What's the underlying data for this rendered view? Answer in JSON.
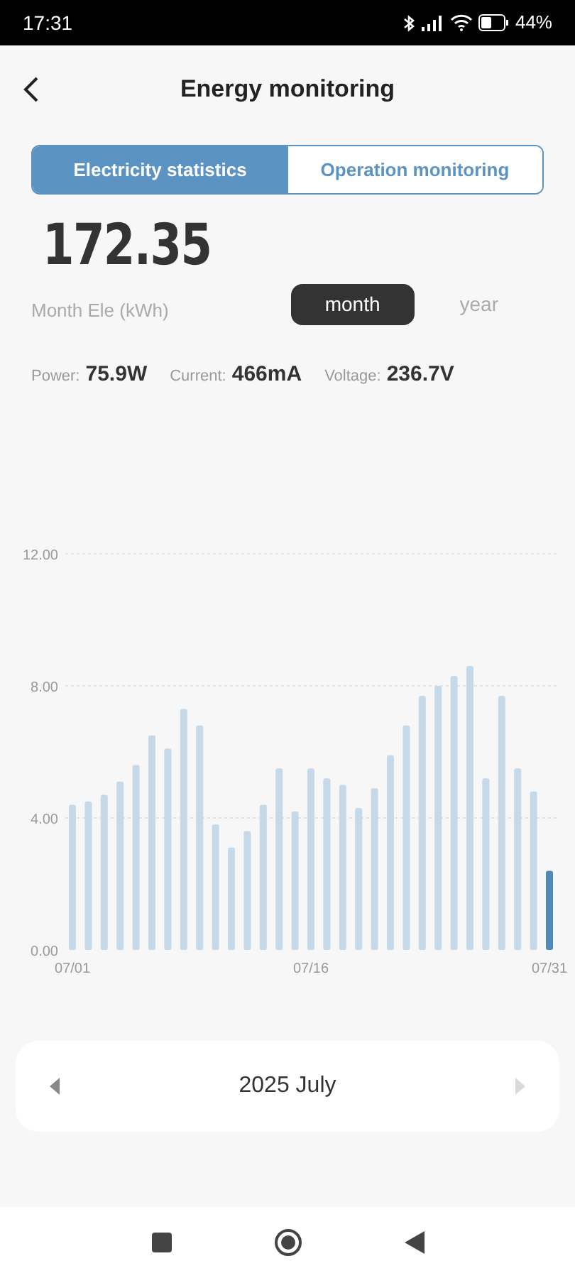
{
  "status_bar": {
    "time": "17:31",
    "battery": "44%"
  },
  "header": {
    "title": "Energy monitoring"
  },
  "tabs": [
    {
      "label": "Electricity statistics",
      "selected": true
    },
    {
      "label": "Operation monitoring",
      "selected": false
    }
  ],
  "total": {
    "value": "172.35",
    "label": "Month Ele (kWh)"
  },
  "period": [
    {
      "label": "month",
      "selected": true
    },
    {
      "label": "year",
      "selected": false
    }
  ],
  "readings": [
    {
      "label": "Power:",
      "value": "75.9W"
    },
    {
      "label": "Current:",
      "value": "466mA"
    },
    {
      "label": "Voltage:",
      "value": "236.7V"
    }
  ],
  "chart": {
    "chart_data": {
      "type": "bar",
      "categories": [
        "07/01",
        null,
        null,
        null,
        null,
        null,
        null,
        null,
        null,
        null,
        null,
        null,
        null,
        null,
        null,
        "07/16",
        null,
        null,
        null,
        null,
        null,
        null,
        null,
        null,
        null,
        null,
        null,
        null,
        null,
        null,
        "07/31"
      ],
      "stacked": true,
      "series": [
        {
          "color": "#c5d9e8",
          "values": [
            4.4,
            4.5,
            4.7,
            5.1,
            5.6,
            6.5,
            6.1,
            7.3,
            6.8,
            3.8,
            3.1,
            3.6,
            4.4,
            5.5,
            4.2,
            5.5,
            5.2,
            5.0,
            4.3,
            4.9,
            5.9,
            6.8,
            7.7,
            8.0,
            8.3,
            8.6,
            5.2,
            7.7,
            5.5,
            4.8,
            null
          ]
        },
        {
          "color": "#4f8ab8",
          "values": [
            null,
            null,
            null,
            null,
            null,
            null,
            null,
            null,
            null,
            null,
            null,
            null,
            null,
            null,
            null,
            null,
            null,
            null,
            null,
            null,
            null,
            null,
            null,
            null,
            null,
            null,
            null,
            null,
            null,
            null,
            2.4
          ]
        }
      ],
      "ylim": [
        0,
        12
      ],
      "yticks": [
        {
          "value": 0,
          "label": "0.00"
        },
        {
          "value": 4,
          "label": "4.00"
        },
        {
          "value": 8,
          "label": "8.00"
        },
        {
          "value": 12,
          "label": "12.00"
        }
      ]
    }
  },
  "date_picker": {
    "label": "2025 July",
    "prev_disabled": false,
    "next_disabled": true
  }
}
